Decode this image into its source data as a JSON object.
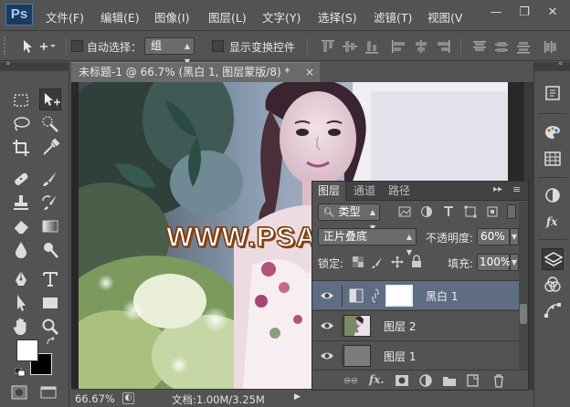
{
  "app": {
    "logo": "Ps"
  },
  "menu": [
    "文件(F)",
    "编辑(E)",
    "图像(I)",
    "图层(L)",
    "文字(Y)",
    "选择(S)",
    "滤镜(T)",
    "视图(V"
  ],
  "window_controls": {
    "minimize": "—",
    "restore": "❐",
    "close": "✕"
  },
  "options_bar": {
    "auto_select_label": "自动选择：",
    "auto_select_target": "组",
    "show_transform_label": "显示变换控件"
  },
  "document": {
    "tab_title": "未标题-1 @ 66.7% (黑白 1, 图层蒙版/8) *",
    "tab_close": "×",
    "watermark": "WWW.PSAHZ.COM"
  },
  "status": {
    "zoom": "66.67%",
    "doc_info": "文档:1.00M/3.25M"
  },
  "layers_panel": {
    "tabs": [
      "图层",
      "通道",
      "路径"
    ],
    "filter_kind": "类型",
    "blend_mode": "正片叠底",
    "opacity_label": "不透明度:",
    "opacity_value": "60%",
    "lock_label": "锁定:",
    "fill_label": "填充:",
    "fill_value": "100%",
    "layers": [
      {
        "name": "黑白 1",
        "selected": true,
        "type": "adjustment"
      },
      {
        "name": "图层 2",
        "selected": false,
        "type": "photo"
      },
      {
        "name": "图层 1",
        "selected": false,
        "type": "gray"
      }
    ]
  },
  "colors": {
    "panel_bg": "#535353",
    "selected_layer": "#5f6d82",
    "watermark_fill": "#ffffff",
    "watermark_stroke": "#7b3d10"
  },
  "icons": {
    "left_tools": [
      "marquee-icon",
      "move-icon",
      "lasso-icon",
      "quick-select-icon",
      "crop-icon",
      "eyedropper-icon",
      "healing-icon",
      "brush-icon",
      "stamp-icon",
      "history-brush-icon",
      "eraser-icon",
      "gradient-icon",
      "blur-icon",
      "dodge-icon",
      "pen-icon",
      "type-icon",
      "path-select-icon",
      "rectangle-icon",
      "hand-icon",
      "zoom-icon"
    ],
    "right_dock": [
      "history-icon",
      "color-icon",
      "swatches-icon",
      "adjustments-icon",
      "styles-icon",
      "layers-icon",
      "channels-icon",
      "paths-icon"
    ]
  }
}
